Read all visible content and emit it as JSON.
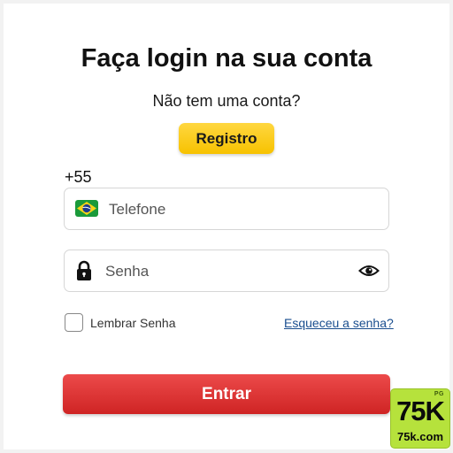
{
  "login": {
    "title": "Faça login na sua conta",
    "no_account_text": "Não tem uma conta?",
    "register_label": "Registro",
    "country_code": "+55",
    "phone_placeholder": "Telefone",
    "password_placeholder": "Senha",
    "remember_label": "Lembrar Senha",
    "forgot_label": "Esqueceu a senha?",
    "submit_label": "Entrar"
  },
  "badge": {
    "tag": "PG",
    "main": "75K",
    "sub": "75k.com"
  },
  "icons": {
    "flag": "brazil-flag-icon",
    "lock": "lock-icon",
    "eye": "eye-icon"
  },
  "colors": {
    "register_button": "#f7c200",
    "submit_button": "#e03535",
    "link": "#1a4e8f",
    "badge": "#b6e23c"
  }
}
